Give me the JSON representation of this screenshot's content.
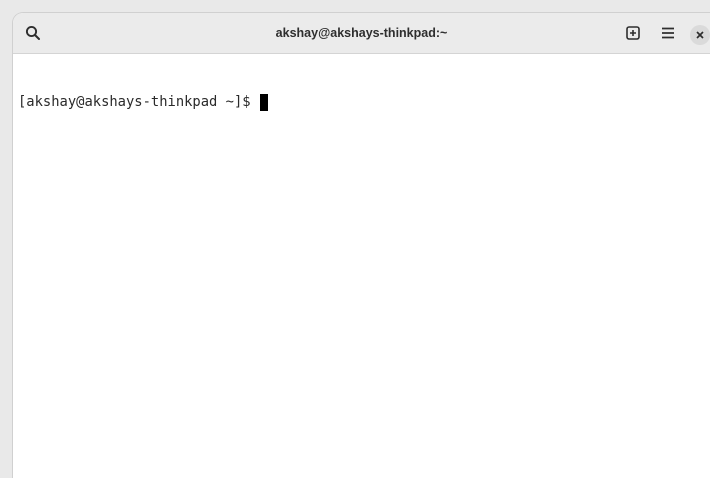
{
  "window": {
    "title": "akshay@akshays-thinkpad:~"
  },
  "headerbar": {
    "search_icon": "search-icon",
    "new_tab_icon": "new-tab-icon",
    "menu_icon": "hamburger-menu-icon",
    "close_icon": "close-icon"
  },
  "terminal": {
    "prompt": "[akshay@akshays-thinkpad ~]$"
  },
  "colors": {
    "headerbar_bg": "#ebebeb",
    "terminal_bg": "#ffffff",
    "text": "#2a2a2a",
    "cursor": "#000000"
  }
}
